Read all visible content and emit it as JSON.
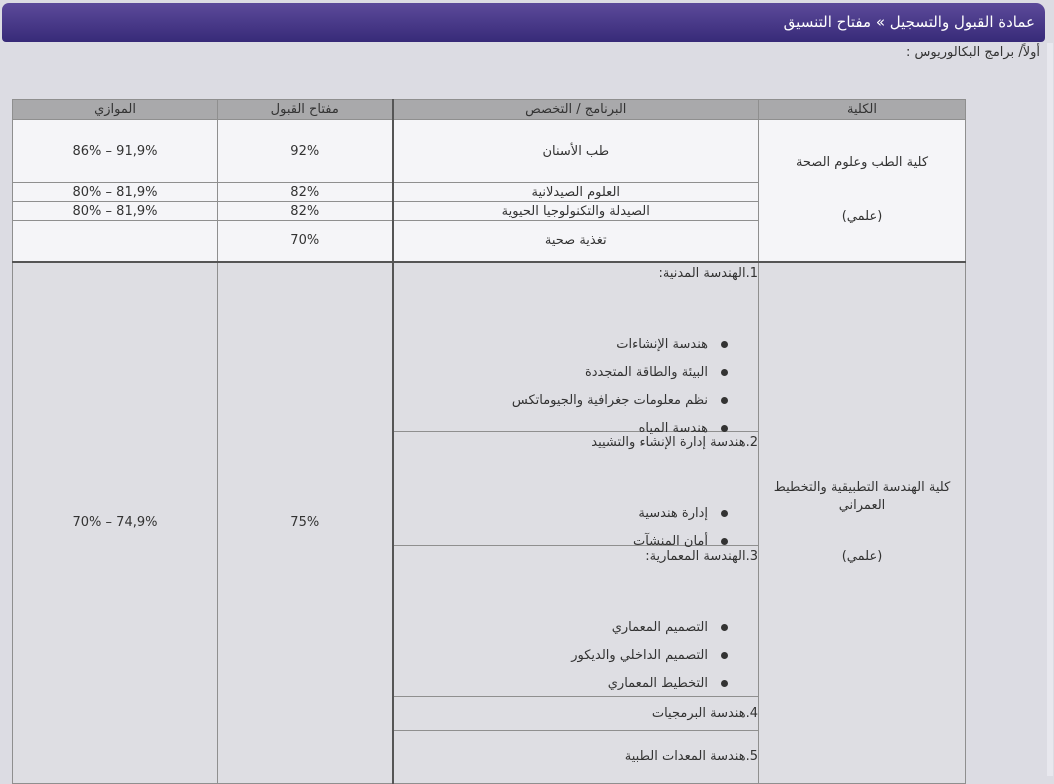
{
  "header": {
    "title": "عمادة القبول والتسجيل » مفتاح التنسيق"
  },
  "subtitle": "أولاً/ برامج البكالوريوس :",
  "table": {
    "headers": {
      "college": "الكلية",
      "program": "البرنامج  /  التخصص",
      "admission_key": "مفتاح القبول",
      "parallel": "الموازي"
    },
    "group1": {
      "college_name": "كلية الطب وعلوم الصحة",
      "college_stream": "(علمي)",
      "rows": [
        {
          "program": "طب الأسنان",
          "key": "92%",
          "parallel": "91,9% – 86%"
        },
        {
          "program": "العلوم الصيدلانية",
          "key": "82%",
          "parallel": "81,9% – 80%"
        },
        {
          "program": "الصيدلة والتكنولوجيا الحيوية",
          "key": "82%",
          "parallel": "81,9% – 80%"
        },
        {
          "program": "تغذية صحية",
          "key": "70%",
          "parallel": ""
        }
      ]
    },
    "group2": {
      "college_name": "كلية الهندسة التطبيقية والتخطيط العمراني",
      "college_stream": "(علمي)",
      "key": "75%",
      "parallel": "74,9% – 70%",
      "programs": [
        {
          "title": "1.الهندسة المدنية:",
          "items": [
            "هندسة الإنشاءات",
            "البيئة والطاقة المتجددة",
            "نظم معلومات جغرافية والجيوماتكس",
            "هندسة المياه"
          ]
        },
        {
          "title": "2.هندسة إدارة الإنشاء والتشييد",
          "items": [
            "إدارة  هندسية",
            "أمان المنشآت"
          ]
        },
        {
          "title": "3.الهندسة المعمارية:",
          "items": [
            "التصميم المعماري",
            "التصميم الداخلي والديكور",
            "التخطيط المعماري"
          ]
        },
        {
          "title": "4.هندسة البرمجيات",
          "items": []
        },
        {
          "title": "5.هندسة المعدات الطبية",
          "items": []
        }
      ]
    }
  }
}
